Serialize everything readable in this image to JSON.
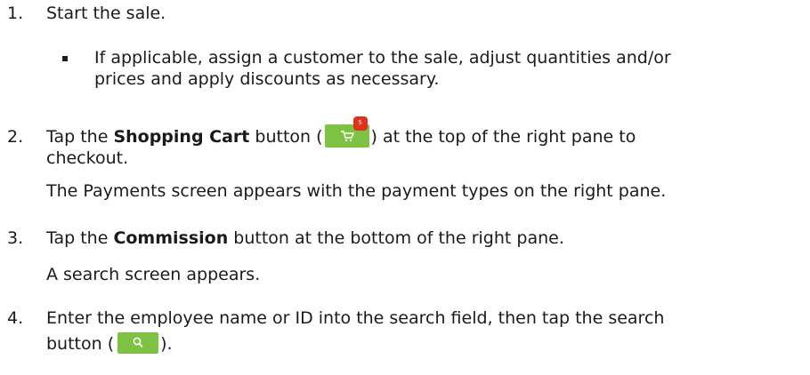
{
  "steps": [
    {
      "num": "1.",
      "text": "Start the sale."
    },
    {
      "num": "2.",
      "pre": "Tap the ",
      "bold": "Shopping Cart",
      "mid": " button (",
      "post": ") at the top of the right pane to",
      "cont": "checkout."
    },
    {
      "num": "3.",
      "pre": "Tap the ",
      "bold": "Commission",
      "post": " button at the bottom of the right pane."
    },
    {
      "num": "4.",
      "line1": "Enter the employee name or ID into the search field, then tap the search",
      "pre2": "button (",
      "post2": ")."
    }
  ],
  "bullet": {
    "line1": "If applicable, assign a customer to the sale, adjust quantities and/or",
    "line2": "prices and apply discounts as necessary."
  },
  "notes": {
    "payments": "The Payments screen appears with the payment types on the right pane.",
    "search_screen": "A search screen appears."
  },
  "icons": {
    "cart": "shopping-cart-icon",
    "search": "search-icon",
    "badge_text": "5",
    "button_color": "#7dc242",
    "badge_color": "#e0321e"
  }
}
